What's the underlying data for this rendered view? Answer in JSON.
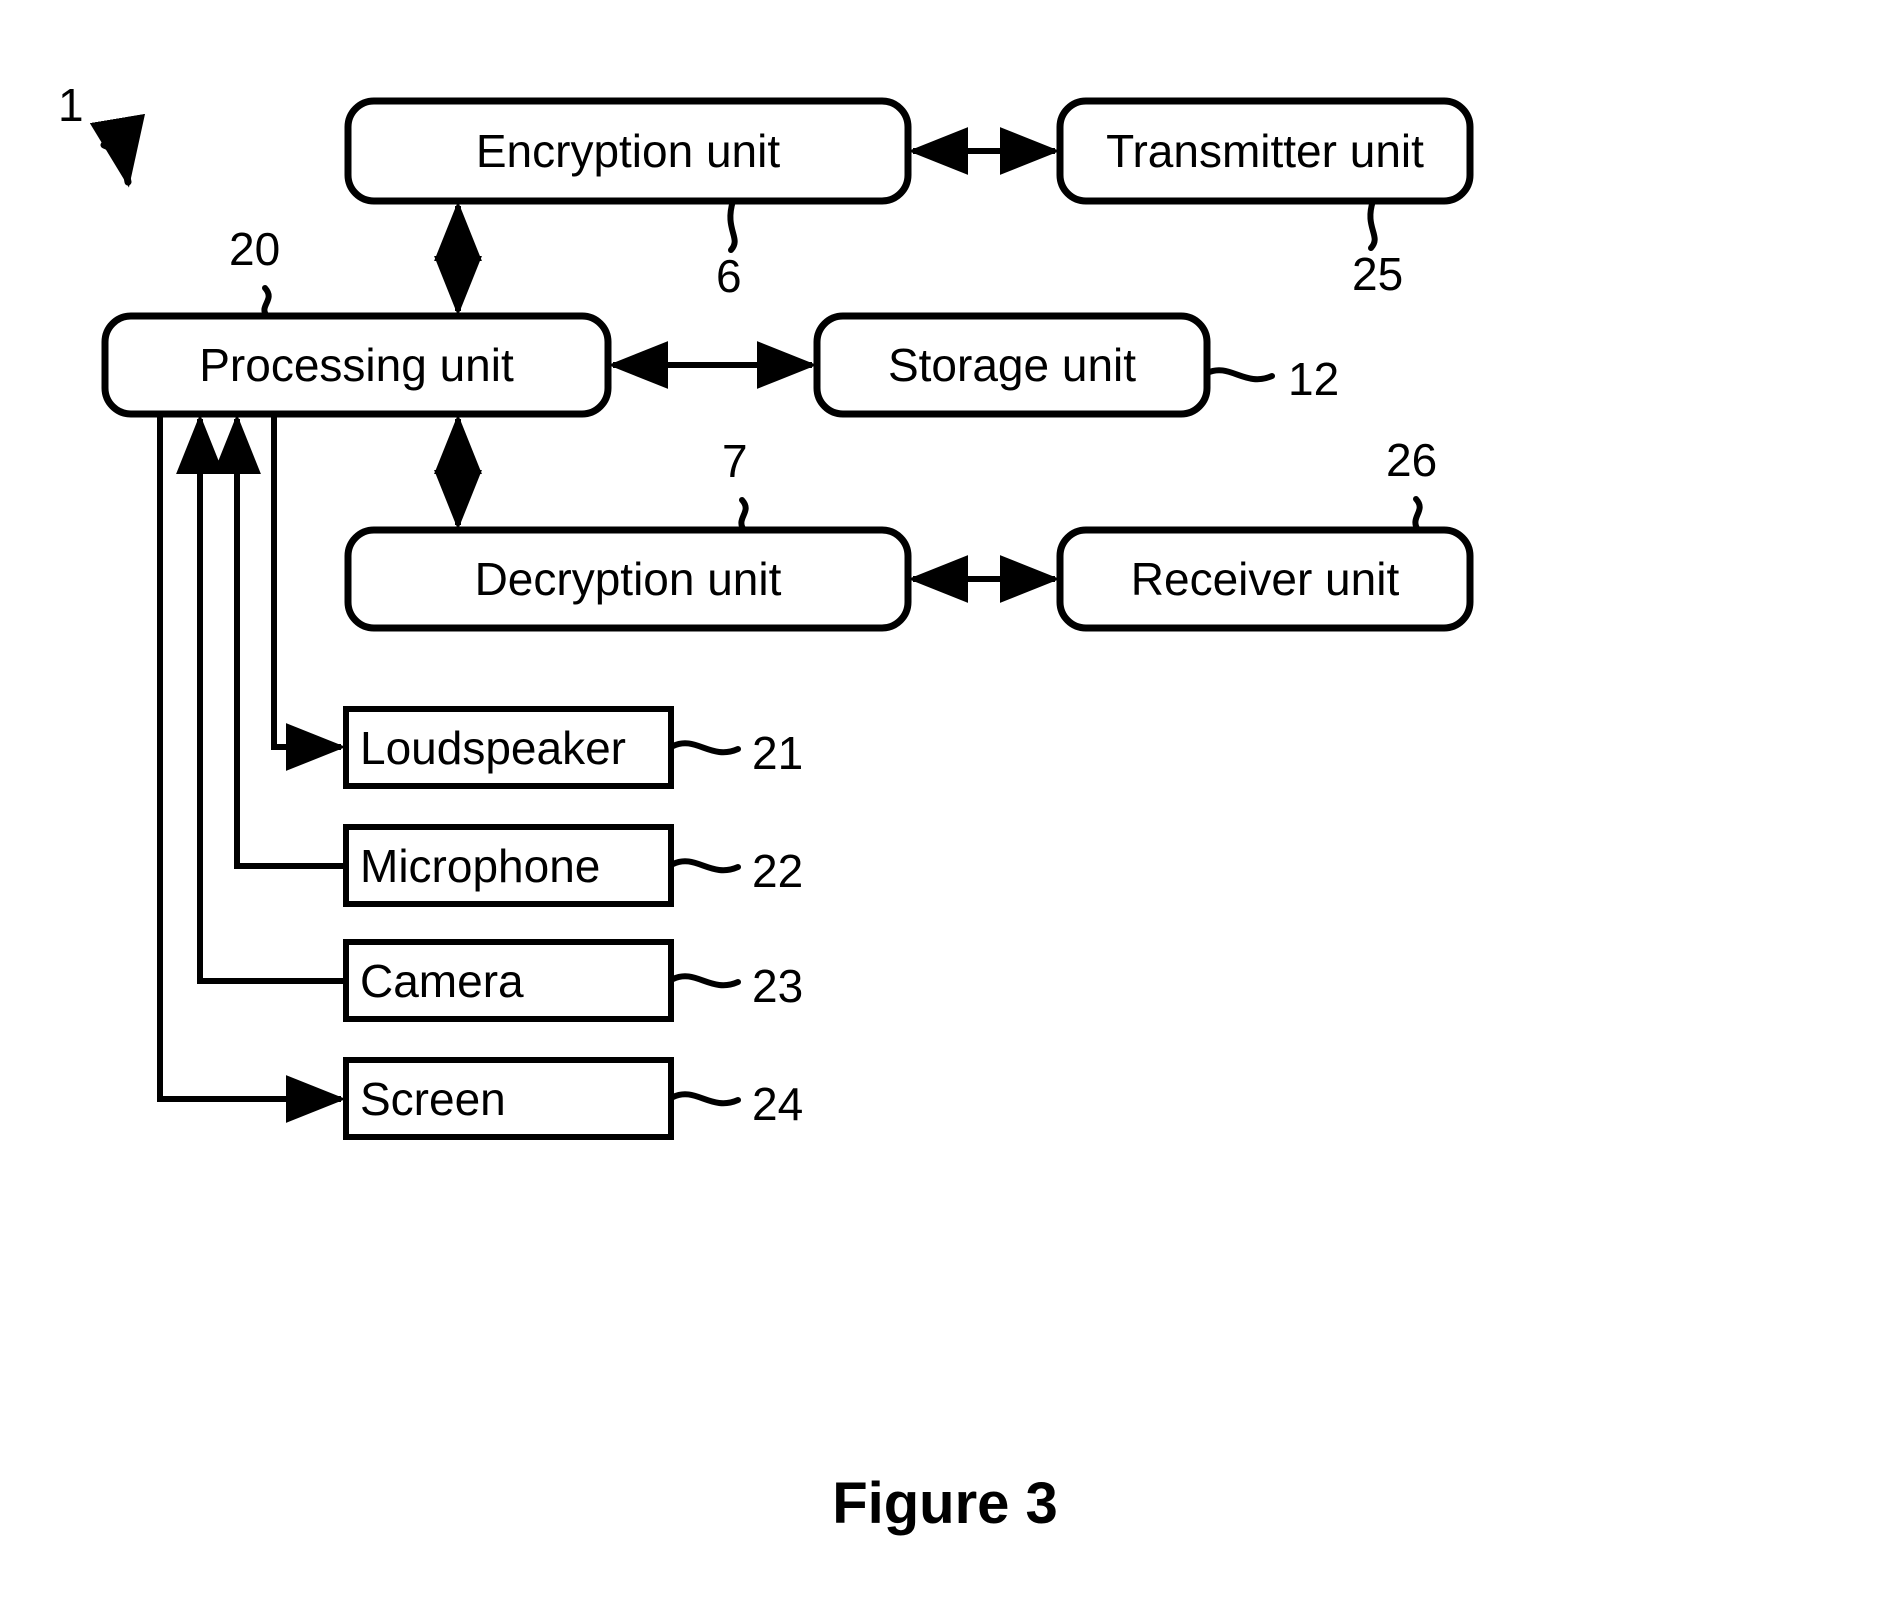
{
  "figure": {
    "caption": "Figure 3",
    "system_ref": "1"
  },
  "nodes": [
    {
      "id": "encryption",
      "label": "Encryption unit",
      "ref": "6",
      "shape": "rounded"
    },
    {
      "id": "transmitter",
      "label": "Transmitter unit",
      "ref": "25",
      "shape": "rounded"
    },
    {
      "id": "processing",
      "label": "Processing unit",
      "ref": "20",
      "shape": "rounded"
    },
    {
      "id": "storage",
      "label": "Storage unit",
      "ref": "12",
      "shape": "rounded"
    },
    {
      "id": "decryption",
      "label": "Decryption unit",
      "ref": "7",
      "shape": "rounded"
    },
    {
      "id": "receiver",
      "label": "Receiver unit",
      "ref": "26",
      "shape": "rounded"
    },
    {
      "id": "loudspeaker",
      "label": "Loudspeaker",
      "ref": "21",
      "shape": "rect"
    },
    {
      "id": "microphone",
      "label": "Microphone",
      "ref": "22",
      "shape": "rect"
    },
    {
      "id": "camera",
      "label": "Camera",
      "ref": "23",
      "shape": "rect"
    },
    {
      "id": "screen",
      "label": "Screen",
      "ref": "24",
      "shape": "rect"
    }
  ],
  "labels": {
    "encryption": "Encryption unit",
    "transmitter": "Transmitter unit",
    "processing": "Processing unit",
    "storage": "Storage unit",
    "decryption": "Decryption unit",
    "receiver": "Receiver unit",
    "loudspeaker": "Loudspeaker",
    "microphone": "Microphone",
    "camera": "Camera",
    "screen": "Screen"
  },
  "refs": {
    "system": "1",
    "encryption": "6",
    "transmitter": "25",
    "processing": "20",
    "storage": "12",
    "decryption": "7",
    "receiver": "26",
    "loudspeaker": "21",
    "microphone": "22",
    "camera": "23",
    "screen": "24"
  },
  "connections": [
    {
      "from": "processing",
      "to": "encryption",
      "arrow": "double"
    },
    {
      "from": "encryption",
      "to": "transmitter",
      "arrow": "double"
    },
    {
      "from": "processing",
      "to": "storage",
      "arrow": "double"
    },
    {
      "from": "processing",
      "to": "decryption",
      "arrow": "double"
    },
    {
      "from": "decryption",
      "to": "receiver",
      "arrow": "double"
    },
    {
      "from": "processing",
      "to": "loudspeaker",
      "arrow": "single"
    },
    {
      "from": "microphone",
      "to": "processing",
      "arrow": "single"
    },
    {
      "from": "camera",
      "to": "processing",
      "arrow": "single"
    },
    {
      "from": "processing",
      "to": "screen",
      "arrow": "single"
    }
  ],
  "colors": {
    "stroke": "#000000",
    "background": "#ffffff",
    "text": "#000000"
  }
}
